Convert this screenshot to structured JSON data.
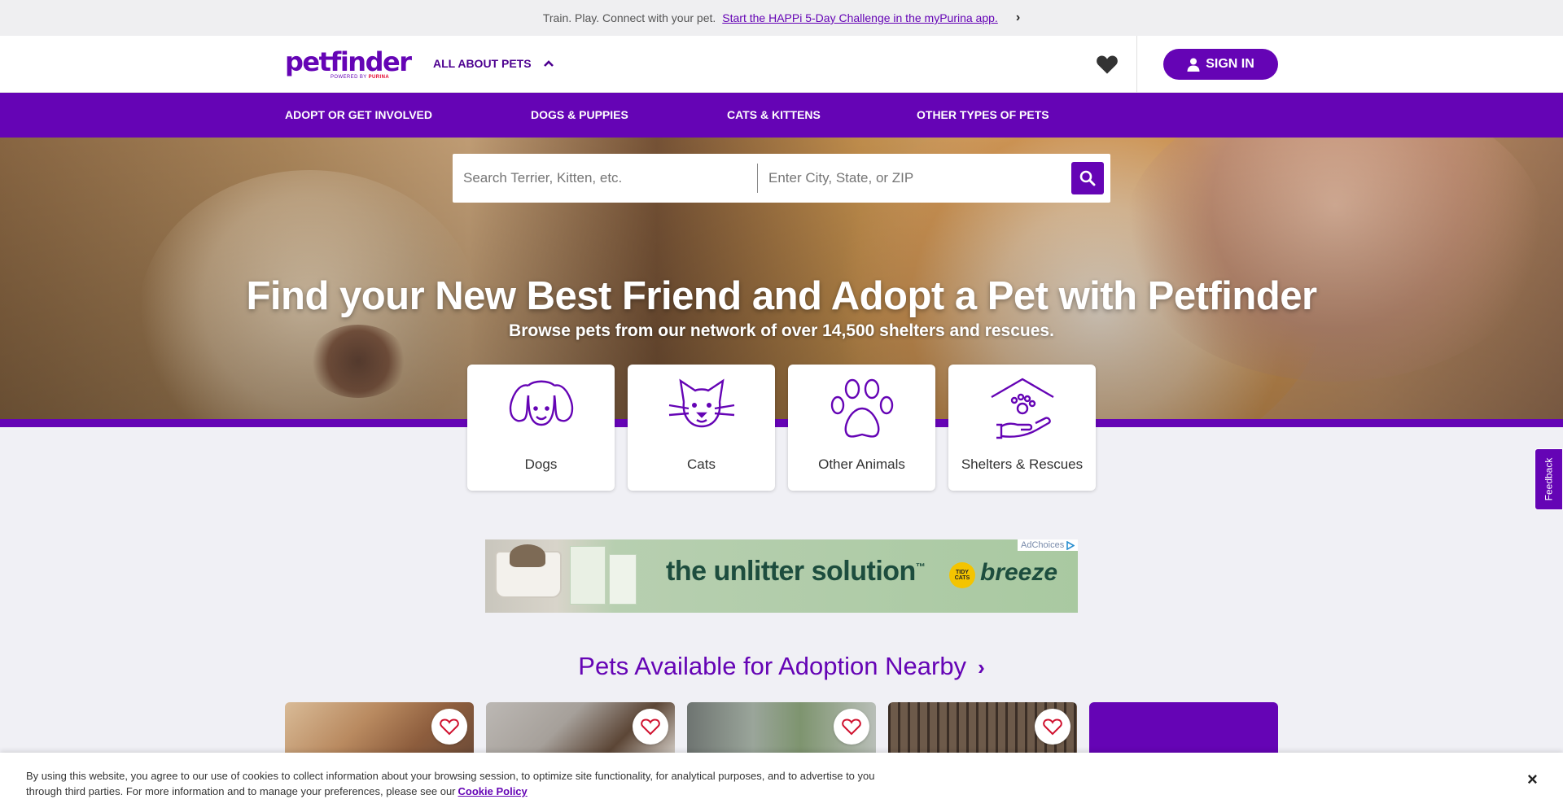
{
  "promo": {
    "text": "Train. Play. Connect with your pet.",
    "link": "Start the HAPPi 5-Day Challenge in the myPurina app.",
    "chevron": "›"
  },
  "header": {
    "logo": "petfinder",
    "logo_tagline": "POWERED BY",
    "logo_tagline_brand": "PURINA",
    "all_about": "ALL ABOUT PETS",
    "all_about_icon": "chevron-up-icon",
    "favorites_icon": "heart-icon",
    "signin": "SIGN IN",
    "signin_icon": "user-icon"
  },
  "nav": {
    "items": [
      "ADOPT OR GET INVOLVED",
      "DOGS & PUPPIES",
      "CATS & KITTENS",
      "OTHER TYPES OF PETS"
    ]
  },
  "search": {
    "pet_placeholder": "Search Terrier, Kitten, etc.",
    "location_placeholder": "Enter City, State, or ZIP",
    "button_icon": "search-icon"
  },
  "hero": {
    "title": "Find your New Best Friend and Adopt a Pet with Petfinder",
    "subtitle": "Browse pets from our network of over 14,500 shelters and rescues."
  },
  "categories": [
    {
      "label": "Dogs",
      "icon": "dog-icon"
    },
    {
      "label": "Cats",
      "icon": "cat-icon"
    },
    {
      "label": "Other Animals",
      "icon": "paw-icon"
    },
    {
      "label": "Shelters & Rescues",
      "icon": "shelter-icon"
    }
  ],
  "feedback": "Feedback",
  "ad": {
    "slogan": "the unlitter solution",
    "trademark": "™",
    "badge": "TIDY CATS",
    "brand": "breeze",
    "adchoices": "AdChoices"
  },
  "section": {
    "title": "Pets Available for Adoption Nearby",
    "chevron": "›"
  },
  "pets": [
    {
      "favorite_icon": "heart-outline-icon"
    },
    {
      "favorite_icon": "heart-outline-icon"
    },
    {
      "favorite_icon": "heart-outline-icon"
    },
    {
      "favorite_icon": "heart-outline-icon"
    }
  ],
  "cookie": {
    "text": "By using this website, you agree to our use of cookies to collect information about your browsing session, to optimize site functionality, for analytical purposes, and to advertise to you through third parties. For more information and to manage your preferences, please see our",
    "link": "Cookie Policy",
    "close": "×"
  },
  "colors": {
    "brand_purple": "#6504b5",
    "dark_purple": "#4d0090",
    "background": "#f0f0f5"
  }
}
